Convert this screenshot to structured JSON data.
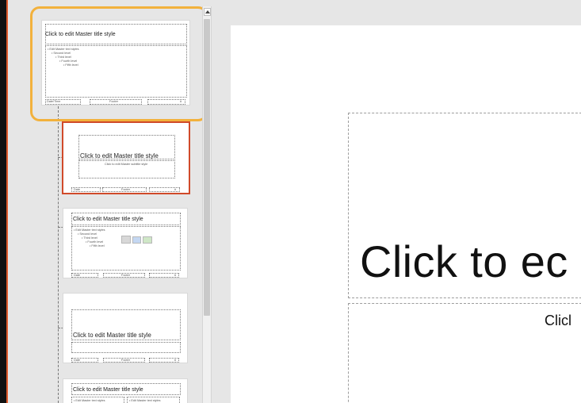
{
  "canvas": {
    "title_text": "Click to ec",
    "subtitle_text": "Clicl"
  },
  "thumbnails": [
    {
      "title": "Click to edit Master title style",
      "body_lines": [
        "• Edit Master text styles",
        "• Second level",
        "• Third level",
        "• Fourth level",
        "• Fifth level"
      ],
      "footer_left": "Date/Time",
      "footer_center": "Footer",
      "footer_right": "#"
    },
    {
      "title": "Click to edit Master title style",
      "subtitle": "Click to edit Master subtitle style",
      "footer_left": "Date",
      "footer_center": "Footer",
      "footer_right": "#"
    },
    {
      "title": "Click to edit Master title style",
      "body_lines": [
        "• Edit Master text styles",
        "• Second level",
        "• Third level",
        "• Fourth level",
        "• Fifth level"
      ],
      "footer_left": "Date",
      "footer_center": "Footer",
      "footer_right": "#"
    },
    {
      "title": "Click to edit Master title style",
      "subtitle": "",
      "footer_left": "Date",
      "footer_center": "Footer",
      "footer_right": "#"
    },
    {
      "title": "Click to edit Master title style",
      "body_left": "• Edit Master text styles",
      "body_right": "• Edit Master text styles"
    }
  ]
}
